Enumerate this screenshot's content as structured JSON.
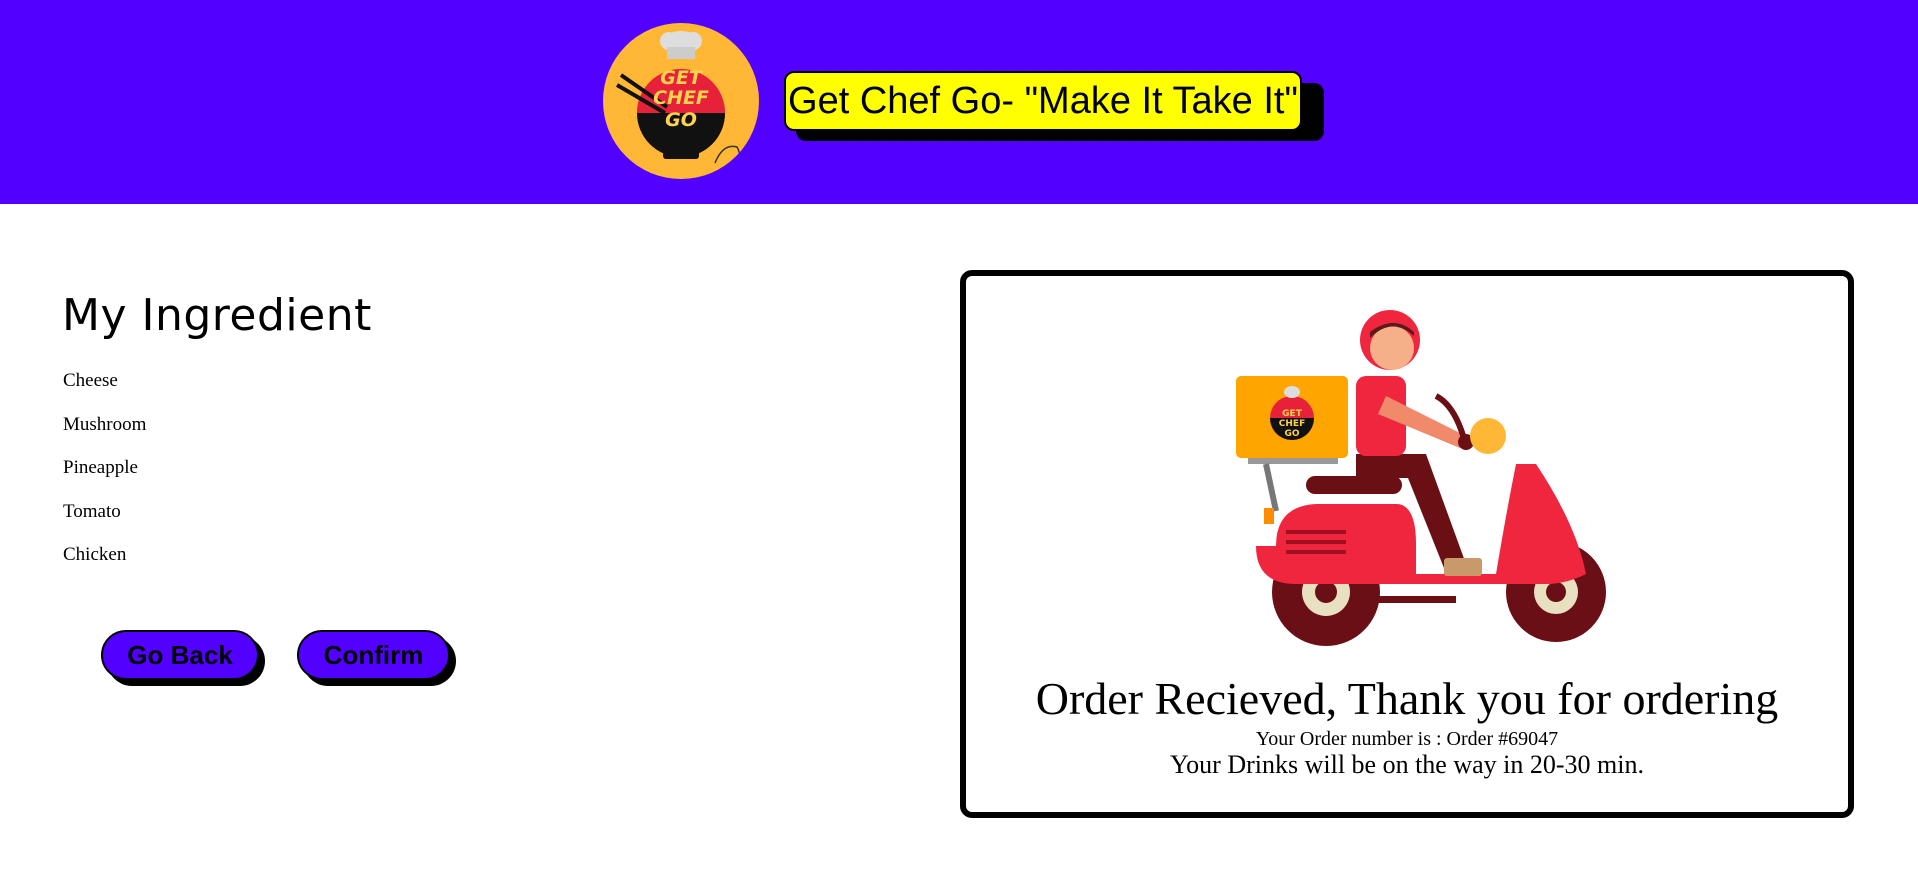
{
  "header": {
    "logo_alt": "Get Chef Go logo",
    "logo_text": [
      "GET",
      "CHEF",
      "GO"
    ],
    "title": "Get Chef Go- \"Make It Take It\"",
    "background_color": "#5200ff",
    "title_background": "#ffff00"
  },
  "ingredients": {
    "heading": "My Ingredient",
    "items": [
      {
        "label": "Cheese"
      },
      {
        "label": "Mushroom"
      },
      {
        "label": "Pineapple"
      },
      {
        "label": "Tomato"
      },
      {
        "label": "Chicken"
      }
    ]
  },
  "buttons": {
    "back_label": "Go Back",
    "confirm_label": "Confirm",
    "color": "#5200ff"
  },
  "order": {
    "illustration": "delivery-scooter-icon",
    "title": "Order Recieved, Thank you for ordering",
    "number_text": "Your Order number is : Order #69047",
    "eta_text": "Your Drinks will be on the way in 20-30 min."
  }
}
